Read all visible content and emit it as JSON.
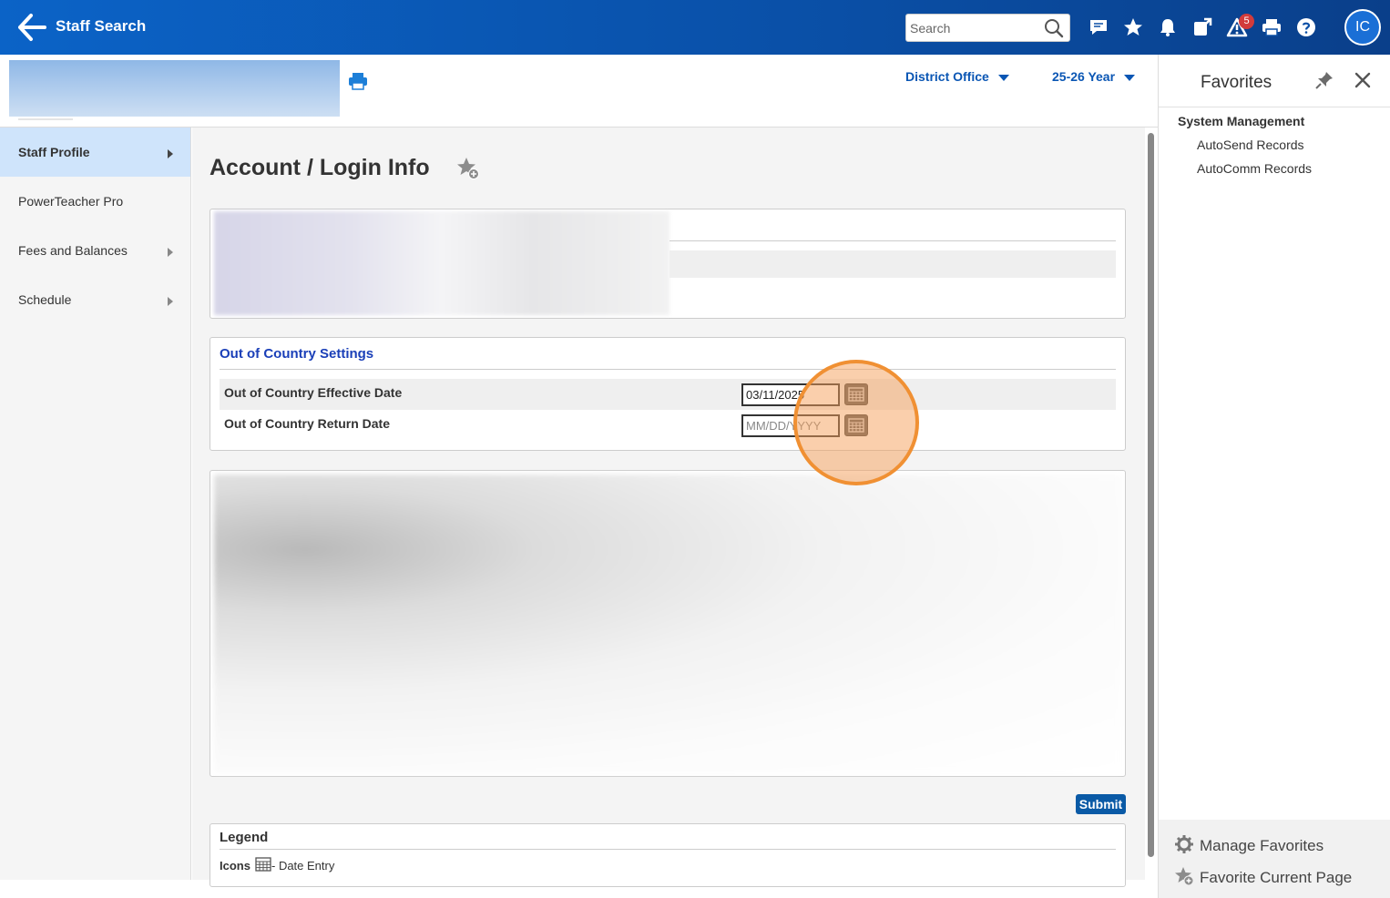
{
  "header": {
    "title": "Staff Search",
    "search_placeholder": "Search",
    "alert_count": "5",
    "avatar_initials": "IC"
  },
  "subheader": {
    "school_dropdown": "District Office",
    "year_dropdown": "25-26 Year"
  },
  "nav": {
    "items": [
      {
        "label": "Staff Profile"
      },
      {
        "label": "PowerTeacher Pro"
      },
      {
        "label": "Fees and Balances"
      },
      {
        "label": "Schedule"
      }
    ]
  },
  "main": {
    "title": "Account / Login Info",
    "section_title": "Out of Country Settings",
    "effective_label": "Out of Country Effective Date",
    "effective_value": "03/11/2025",
    "return_label": "Out of Country Return Date",
    "return_placeholder": "MM/DD/YYYY",
    "submit_label": "Submit",
    "legend_title": "Legend",
    "legend_icons_label": "Icons",
    "legend_date_entry": "- Date Entry"
  },
  "favorites": {
    "title": "Favorites",
    "group": "System Management",
    "links": [
      "AutoSend Records",
      "AutoComm Records"
    ],
    "manage_label": "Manage Favorites",
    "favorite_current_label": "Favorite Current Page"
  },
  "colors": {
    "header_blue": "#0b63c7",
    "link_blue": "#0a56b4",
    "active_nav": "#cfe4fb",
    "highlight_orange": "#f09033"
  }
}
